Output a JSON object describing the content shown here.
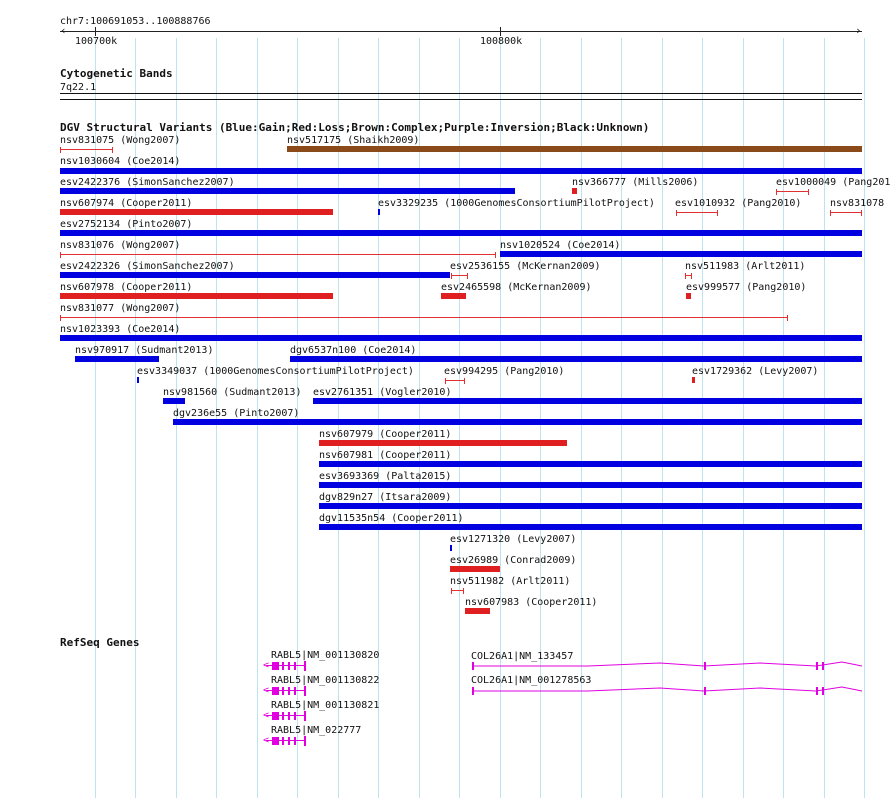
{
  "header": {
    "locus": "chr7:100691053..100888766",
    "ruler_left": "100700k",
    "ruler_mid": "100800k"
  },
  "cyto": {
    "title": "Cytogenetic Bands",
    "band": "7q22.1"
  },
  "dgv": {
    "title": "DGV Structural Variants (Blue:Gain;Red:Loss;Brown:Complex;Purple:Inversion;Black:Unknown)",
    "colors": {
      "gain": "#0000e0",
      "loss": "#e02020",
      "complex": "#8b4a1a"
    },
    "labels": [
      "nsv831075 (Wong2007)",
      "nsv517175 (Shaikh2009)",
      "nsv1030604 (Coe2014)",
      "esv2422376 (SimonSanchez2007)",
      "nsv366777 (Mills2006)",
      "esv1000049 (Pang201",
      "nsv607974 (Cooper2011)",
      "esv3329235 (1000GenomesConsortiumPilotProject)",
      "esv1010932 (Pang2010)",
      "nsv831078",
      "esv2752134 (Pinto2007)",
      "nsv831076 (Wong2007)",
      "nsv1020524 (Coe2014)",
      "esv2422326 (SimonSanchez2007)",
      "esv2536155 (McKernan2009)",
      "nsv511983 (Arlt2011)",
      "nsv607978 (Cooper2011)",
      "esv2465598 (McKernan2009)",
      "esv999577 (Pang2010)",
      "nsv831077 (Wong2007)",
      "nsv1023393 (Coe2014)",
      "nsv970917 (Sudmant2013)",
      "dgv6537n100 (Coe2014)",
      "esv3349037 (1000GenomesConsortiumPilotProject)",
      "esv994295 (Pang2010)",
      "esv1729362 (Levy2007)",
      "nsv981560 (Sudmant2013)",
      "esv2761351 (Vogler2010)",
      "dgv236e55 (Pinto2007)",
      "nsv607979 (Cooper2011)",
      "nsv607981 (Cooper2011)",
      "esv3693369 (Palta2015)",
      "dgv829n27 (Itsara2009)",
      "dgv11535n54 (Cooper2011)",
      "esv1271320 (Levy2007)",
      "esv26989 (Conrad2009)",
      "nsv511982 (Arlt2011)",
      "nsv607983 (Cooper2011)"
    ]
  },
  "refseq": {
    "title": "RefSeq Genes",
    "genes": [
      "RABL5|NM_001130820",
      "RABL5|NM_001130822",
      "RABL5|NM_001130821",
      "RABL5|NM_022777",
      "COL26A1|NM_133457",
      "COL26A1|NM_001278563"
    ]
  }
}
